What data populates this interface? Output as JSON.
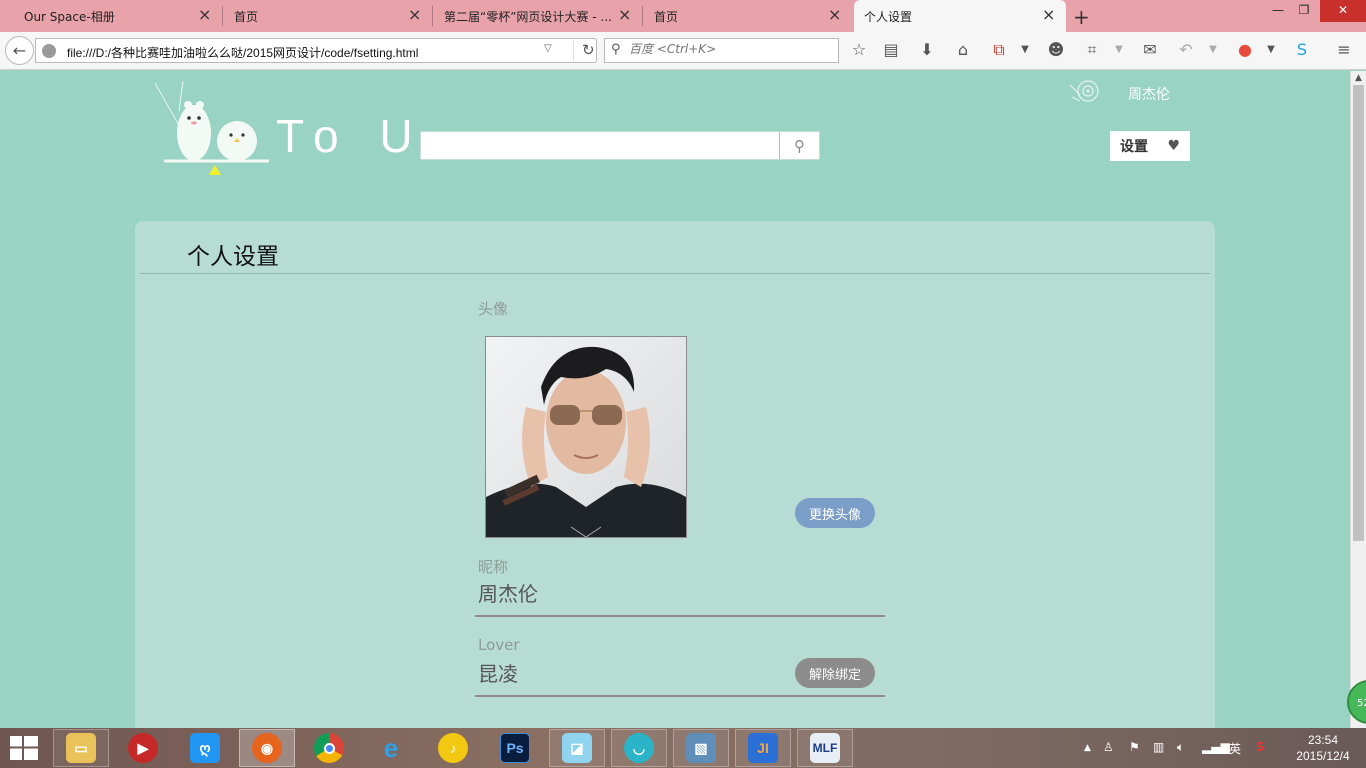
{
  "browser": {
    "tabs": [
      {
        "label": "Our Space-相册"
      },
      {
        "label": "首页"
      },
      {
        "label": "第二届“零杯”网页设计大赛 - ..."
      },
      {
        "label": "首页"
      },
      {
        "label": "个人设置"
      }
    ],
    "active_tab": 4,
    "url": "file:///D:/各种比赛哇加油啦么么哒/2015网页设计/code/fsetting.html",
    "search_placeholder": "百度 <Ctrl+K>"
  },
  "site": {
    "logo_text": "To U",
    "username": "周杰伦",
    "search_value": "",
    "settings_label": "设置"
  },
  "settings": {
    "title": "个人设置",
    "avatar_label": "头像",
    "change_avatar_label": "更换头像",
    "nickname_label": "昵称",
    "nickname_value": "周杰伦",
    "lover_label": "Lover",
    "lover_value": "昆凌",
    "unbind_label": "解除绑定"
  },
  "side_badge": "52",
  "taskbar": {
    "apps": [
      "file-explorer",
      "media-player",
      "input-tool",
      "firefox",
      "chrome",
      "internet-explorer",
      "music-player",
      "photoshop",
      "notes",
      "cloud-app",
      "image-viewer",
      "jetbrains-app",
      "media-app"
    ],
    "ime": "英",
    "time": "23:54",
    "date": "2015/12/4"
  },
  "colors": {
    "page_bg": "#99d3c3",
    "panel_bg": "#b7dcd4",
    "tab_bar": "#e8a2aa",
    "change_avatar_btn": "#7b9ec8",
    "unbind_btn": "#8c8c8c"
  }
}
